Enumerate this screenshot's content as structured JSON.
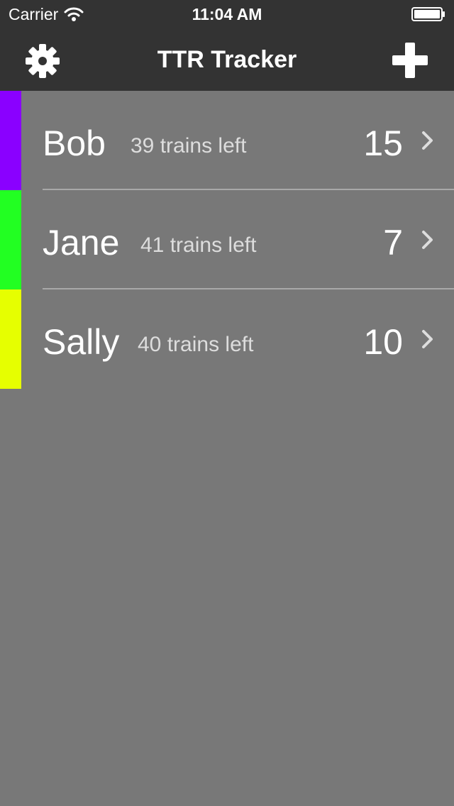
{
  "status_bar": {
    "carrier": "Carrier",
    "time": "11:04 AM",
    "wifi_icon": "wifi-icon",
    "battery_icon": "battery-full-icon"
  },
  "nav": {
    "title": "TTR Tracker",
    "left_icon": "gear-icon",
    "right_icon": "plus-icon"
  },
  "colors": {
    "nav_background": "#333333",
    "list_background": "#787878",
    "separator": "#a8a8a8"
  },
  "players": [
    {
      "name": "Bob",
      "trains_left": "39 trains left",
      "score": "15",
      "color": "#8a00ff"
    },
    {
      "name": "Jane",
      "trains_left": "41 trains left",
      "score": "7",
      "color": "#22ff22"
    },
    {
      "name": "Sally",
      "trains_left": "40 trains left",
      "score": "10",
      "color": "#e6ff00"
    }
  ]
}
